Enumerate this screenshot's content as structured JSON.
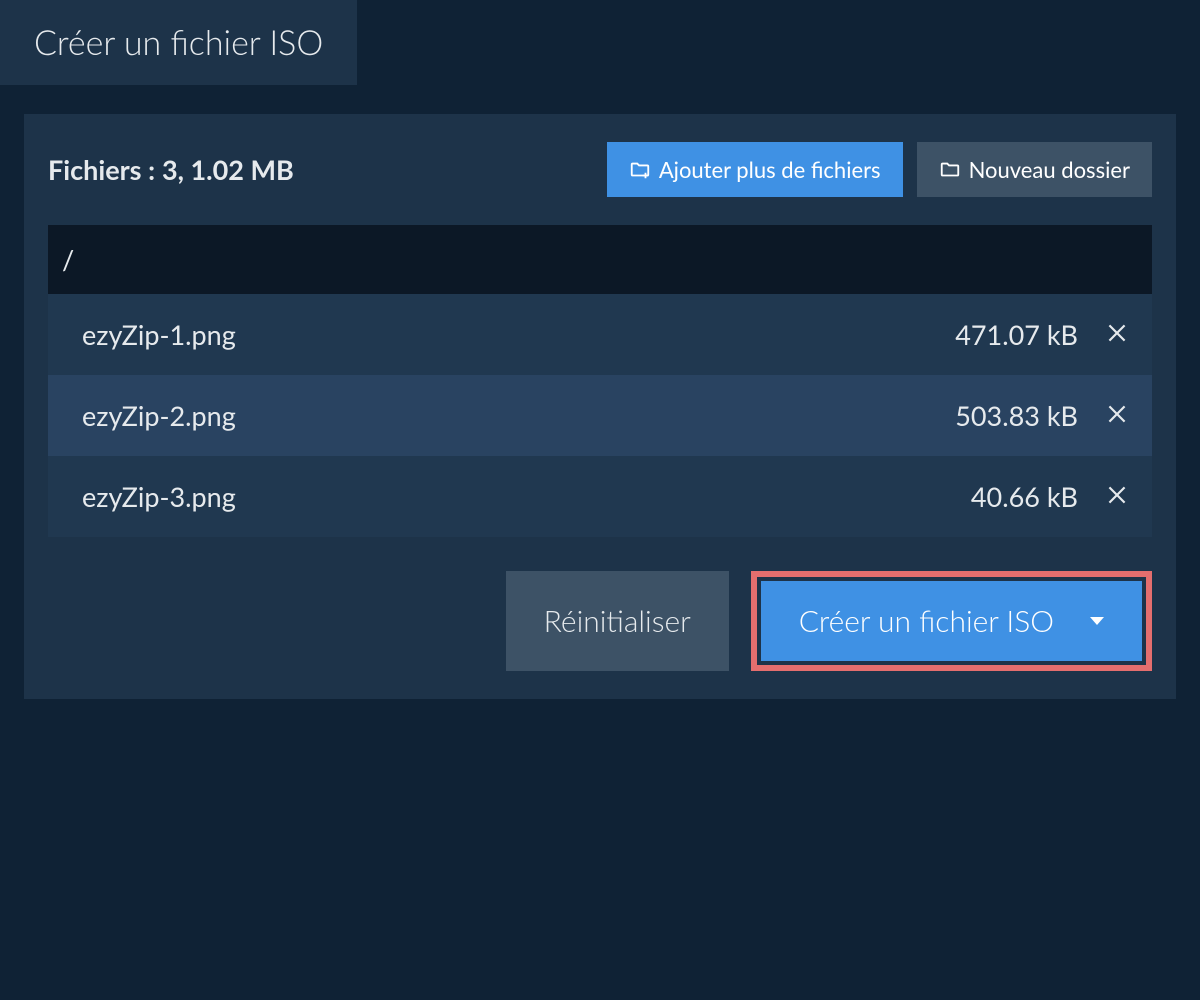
{
  "tab": {
    "title": "Créer un fichier ISO"
  },
  "summary": {
    "label": "Fichiers :",
    "value": "3, 1.02 MB"
  },
  "buttons": {
    "add_files": "Ajouter plus de fichiers",
    "new_folder": "Nouveau dossier",
    "reset": "Réinitialiser",
    "create": "Créer un fichier ISO"
  },
  "path": "/",
  "files": [
    {
      "name": "ezyZip-1.png",
      "size": "471.07 kB"
    },
    {
      "name": "ezyZip-2.png",
      "size": "503.83 kB"
    },
    {
      "name": "ezyZip-3.png",
      "size": "40.66 kB"
    }
  ]
}
